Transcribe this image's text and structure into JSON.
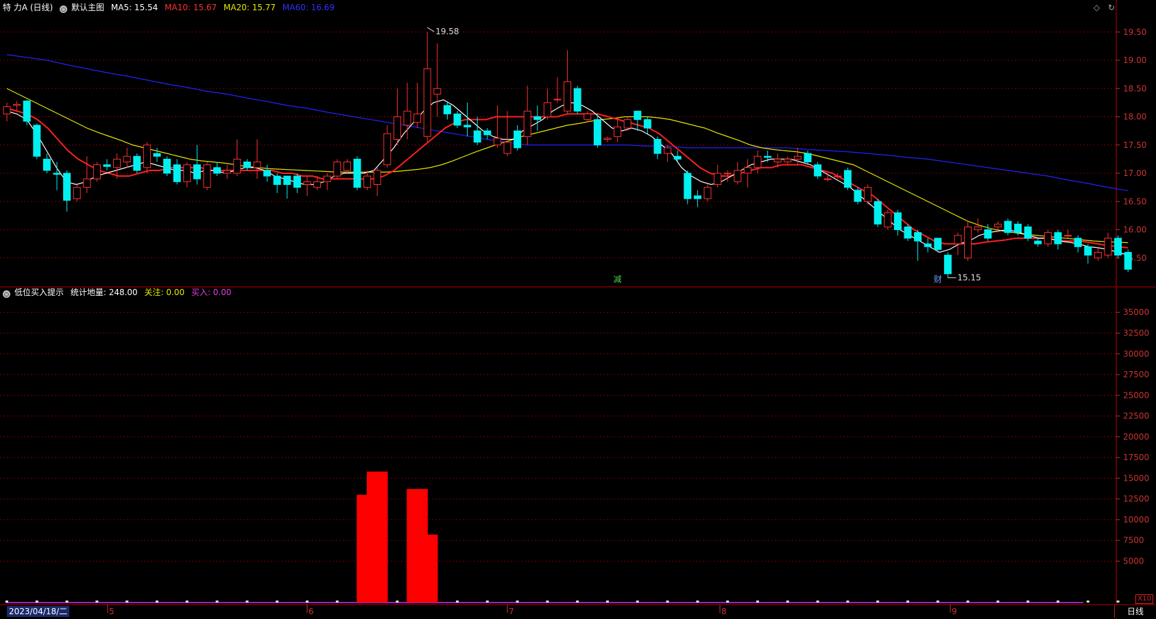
{
  "header": {
    "stock_title": "特 力A (日线)",
    "main_indicator": "默认主图",
    "ma5_label": "MA5: 15.54",
    "ma10_label": "MA10: 15.67",
    "ma20_label": "MA20: 15.77",
    "ma60_label": "MA60: 16.69"
  },
  "sub_header": {
    "indicator_name": "低位买入提示",
    "stat_label": "统计地量: 248.00",
    "watch_label": "关注: 0.00",
    "buy_label": "买入: 0.00"
  },
  "annotations": {
    "high_label": "19.58",
    "low_label": "15.15",
    "marker_jian": "减",
    "marker_cai": "财"
  },
  "price_axis_labels": [
    "19.50",
    "19.00",
    "18.50",
    "18.00",
    "17.50",
    "17.00",
    "16.50",
    "16.00",
    "15.50"
  ],
  "volume_axis_labels": [
    "35000",
    "32500",
    "30000",
    "27500",
    "25000",
    "22500",
    "20000",
    "17500",
    "15000",
    "12500",
    "10000",
    "7500",
    "5000"
  ],
  "x_axis": {
    "date_label": "2023/04/18/二",
    "month_labels": [
      "5",
      "6",
      "7",
      "8",
      "9"
    ]
  },
  "bottom_right": {
    "scale_label": "X10",
    "period_label": "日线"
  },
  "colors": {
    "up": "#ff3030",
    "down": "#00f0f0",
    "ma5": "#ffffff",
    "ma10": "#ff2020",
    "ma20": "#e8e800",
    "ma60": "#2222ff",
    "grid": "#7a0000",
    "axis_text": "#cc3333",
    "volume_bar": "#ff0000",
    "baseline": "#a020c0"
  },
  "icons": {
    "header_circle": "circle-icon",
    "diamond": "diamond-icon",
    "refresh": "refresh-icon"
  },
  "chart_data": {
    "type": "candlestick",
    "title": "特 力A (日线)",
    "ylim": [
      15.0,
      19.8
    ],
    "candles": [
      [
        18.05,
        18.18,
        17.92,
        18.25
      ],
      [
        18.2,
        18.22,
        18.1,
        18.28
      ],
      [
        18.28,
        17.92,
        17.85,
        18.3
      ],
      [
        17.85,
        17.3,
        17.25,
        17.88
      ],
      [
        17.25,
        17.05,
        17.0,
        17.35
      ],
      [
        17.0,
        16.98,
        16.7,
        17.2
      ],
      [
        17.0,
        16.52,
        16.32,
        17.05
      ],
      [
        16.55,
        16.75,
        16.5,
        16.8
      ],
      [
        16.75,
        16.9,
        16.65,
        17.3
      ],
      [
        16.9,
        17.15,
        16.85,
        17.2
      ],
      [
        17.15,
        17.12,
        17.05,
        17.25
      ],
      [
        17.1,
        17.25,
        16.9,
        17.35
      ],
      [
        17.2,
        17.3,
        17.1,
        17.45
      ],
      [
        17.3,
        17.05,
        17.0,
        17.35
      ],
      [
        17.1,
        17.5,
        17.0,
        17.55
      ],
      [
        17.35,
        17.3,
        17.2,
        17.45
      ],
      [
        17.25,
        17.0,
        16.95,
        17.3
      ],
      [
        17.15,
        16.85,
        16.8,
        17.25
      ],
      [
        16.85,
        17.15,
        16.75,
        17.2
      ],
      [
        17.15,
        16.9,
        16.8,
        17.5
      ],
      [
        16.75,
        17.15,
        16.7,
        17.2
      ],
      [
        17.1,
        17.0,
        16.95,
        17.2
      ],
      [
        17.0,
        17.05,
        16.9,
        17.15
      ],
      [
        17.0,
        17.25,
        16.95,
        17.6
      ],
      [
        17.2,
        17.1,
        17.05,
        17.25
      ],
      [
        17.1,
        17.2,
        16.9,
        17.6
      ],
      [
        17.05,
        16.95,
        16.85,
        17.15
      ],
      [
        16.95,
        16.8,
        16.65,
        17.0
      ],
      [
        16.95,
        16.8,
        16.55,
        16.95
      ],
      [
        16.95,
        16.75,
        16.65,
        17.0
      ],
      [
        16.8,
        16.85,
        16.6,
        16.95
      ],
      [
        16.75,
        16.85,
        16.7,
        16.95
      ],
      [
        16.85,
        16.95,
        16.7,
        17.0
      ],
      [
        16.95,
        17.2,
        16.9,
        17.25
      ],
      [
        17.05,
        17.2,
        17.0,
        17.25
      ],
      [
        17.25,
        16.75,
        16.7,
        17.3
      ],
      [
        16.75,
        16.95,
        16.7,
        17.05
      ],
      [
        16.8,
        17.05,
        16.6,
        17.1
      ],
      [
        17.15,
        17.7,
        17.1,
        17.85
      ],
      [
        17.6,
        18.0,
        17.5,
        18.5
      ],
      [
        17.85,
        18.1,
        17.6,
        18.6
      ],
      [
        17.9,
        18.05,
        17.8,
        18.6
      ],
      [
        17.65,
        18.85,
        17.55,
        19.5
      ],
      [
        18.4,
        18.5,
        18.0,
        19.3
      ],
      [
        18.2,
        18.05,
        17.95,
        18.25
      ],
      [
        18.05,
        17.85,
        17.8,
        18.1
      ],
      [
        17.85,
        17.82,
        17.65,
        18.25
      ],
      [
        17.75,
        17.55,
        17.5,
        18.0
      ],
      [
        17.75,
        17.68,
        17.6,
        17.8
      ],
      [
        17.5,
        17.62,
        17.45,
        18.2
      ],
      [
        17.35,
        17.55,
        17.3,
        18.1
      ],
      [
        17.75,
        17.45,
        17.4,
        17.85
      ],
      [
        17.65,
        18.1,
        17.5,
        18.55
      ],
      [
        18.0,
        17.95,
        17.75,
        18.2
      ],
      [
        18.0,
        18.25,
        17.95,
        18.5
      ],
      [
        18.3,
        18.31,
        18.25,
        18.7
      ],
      [
        18.1,
        18.62,
        18.05,
        19.18
      ],
      [
        18.5,
        18.1,
        18.05,
        18.55
      ],
      [
        17.95,
        18.05,
        17.9,
        18.1
      ],
      [
        17.95,
        17.5,
        17.45,
        18.05
      ],
      [
        17.6,
        17.62,
        17.55,
        17.65
      ],
      [
        17.65,
        17.82,
        17.55,
        18.0
      ],
      [
        17.8,
        17.95,
        17.75,
        18.0
      ],
      [
        18.1,
        17.95,
        17.75,
        18.1
      ],
      [
        17.95,
        17.8,
        17.7,
        18.0
      ],
      [
        17.6,
        17.35,
        17.25,
        17.65
      ],
      [
        17.35,
        17.45,
        17.2,
        17.5
      ],
      [
        17.3,
        17.25,
        17.2,
        17.4
      ],
      [
        17.0,
        16.55,
        16.45,
        17.05
      ],
      [
        16.6,
        16.55,
        16.4,
        16.7
      ],
      [
        16.55,
        16.75,
        16.5,
        16.8
      ],
      [
        16.8,
        17.0,
        16.75,
        17.15
      ],
      [
        17.0,
        17.0,
        16.85,
        17.05
      ],
      [
        16.85,
        17.05,
        16.8,
        17.2
      ],
      [
        17.0,
        17.1,
        16.75,
        17.25
      ],
      [
        17.1,
        17.3,
        17.0,
        17.4
      ],
      [
        17.3,
        17.28,
        17.2,
        17.4
      ],
      [
        17.2,
        17.25,
        17.1,
        17.35
      ],
      [
        17.2,
        17.25,
        17.15,
        17.3
      ],
      [
        17.25,
        17.3,
        17.15,
        17.45
      ],
      [
        17.35,
        17.2,
        17.15,
        17.4
      ],
      [
        17.15,
        16.95,
        16.9,
        17.2
      ],
      [
        16.9,
        16.9,
        16.85,
        17.0
      ],
      [
        16.95,
        16.95,
        16.9,
        17.0
      ],
      [
        17.05,
        16.75,
        16.7,
        17.1
      ],
      [
        16.7,
        16.5,
        16.45,
        16.75
      ],
      [
        16.5,
        16.75,
        16.45,
        16.8
      ],
      [
        16.5,
        16.1,
        16.05,
        16.55
      ],
      [
        16.05,
        16.3,
        16.0,
        16.35
      ],
      [
        16.3,
        16.0,
        15.9,
        16.35
      ],
      [
        16.05,
        15.85,
        15.8,
        16.1
      ],
      [
        15.95,
        15.8,
        15.45,
        16.0
      ],
      [
        15.75,
        15.7,
        15.6,
        15.85
      ],
      [
        15.85,
        15.65,
        15.6,
        15.85
      ],
      [
        15.55,
        15.22,
        15.15,
        15.6
      ],
      [
        15.75,
        15.9,
        15.55,
        15.95
      ],
      [
        15.5,
        16.05,
        15.45,
        16.15
      ],
      [
        16.0,
        16.05,
        15.95,
        16.2
      ],
      [
        16.0,
        15.85,
        15.8,
        16.1
      ],
      [
        16.05,
        16.1,
        15.95,
        16.15
      ],
      [
        16.15,
        15.95,
        15.9,
        16.2
      ],
      [
        16.1,
        15.95,
        15.9,
        16.15
      ],
      [
        16.05,
        15.85,
        15.8,
        16.1
      ],
      [
        15.8,
        15.75,
        15.7,
        15.85
      ],
      [
        15.75,
        15.95,
        15.7,
        16.0
      ],
      [
        15.95,
        15.75,
        15.65,
        16.0
      ],
      [
        15.9,
        15.9,
        15.85,
        16.0
      ],
      [
        15.85,
        15.7,
        15.6,
        15.9
      ],
      [
        15.7,
        15.55,
        15.4,
        15.75
      ],
      [
        15.5,
        15.6,
        15.45,
        15.7
      ],
      [
        15.55,
        15.85,
        15.5,
        15.95
      ],
      [
        15.85,
        15.55,
        15.5,
        15.9
      ],
      [
        15.6,
        15.3,
        15.25,
        15.65
      ]
    ],
    "ma5": [
      18.1,
      18.05,
      17.95,
      17.7,
      17.4,
      17.1,
      16.85,
      16.8,
      16.85,
      16.95,
      17.0,
      17.05,
      17.1,
      17.15,
      17.2,
      17.15,
      17.1,
      17.05,
      17.05,
      17.0,
      17.05,
      17.05,
      17.0,
      17.05,
      17.1,
      17.1,
      17.05,
      16.95,
      16.9,
      16.85,
      16.8,
      16.8,
      16.85,
      16.95,
      17.0,
      17.0,
      17.0,
      17.05,
      17.25,
      17.45,
      17.7,
      17.9,
      18.1,
      18.25,
      18.3,
      18.2,
      18.05,
      17.9,
      17.75,
      17.65,
      17.6,
      17.6,
      17.75,
      17.85,
      17.95,
      18.1,
      18.2,
      18.25,
      18.2,
      18.1,
      17.95,
      17.8,
      17.75,
      17.8,
      17.75,
      17.65,
      17.5,
      17.35,
      17.1,
      16.95,
      16.85,
      16.8,
      16.85,
      16.95,
      17.05,
      17.15,
      17.2,
      17.25,
      17.25,
      17.25,
      17.2,
      17.15,
      17.05,
      16.95,
      16.85,
      16.75,
      16.6,
      16.45,
      16.3,
      16.15,
      16.0,
      15.9,
      15.8,
      15.7,
      15.6,
      15.65,
      15.75,
      15.8,
      15.9,
      15.95,
      15.98,
      16.0,
      15.95,
      15.9,
      15.85,
      15.85,
      15.8,
      15.78,
      15.75,
      15.7,
      15.68,
      15.65,
      15.6,
      15.55
    ],
    "ma10": [
      18.15,
      18.1,
      18.05,
      17.95,
      17.8,
      17.6,
      17.4,
      17.25,
      17.15,
      17.05,
      17.0,
      16.95,
      16.95,
      17.0,
      17.05,
      17.05,
      17.1,
      17.1,
      17.1,
      17.1,
      17.05,
      17.05,
      17.05,
      17.05,
      17.05,
      17.05,
      17.05,
      17.0,
      17.0,
      16.95,
      16.95,
      16.9,
      16.9,
      16.9,
      16.9,
      16.9,
      16.9,
      16.95,
      17.05,
      17.2,
      17.35,
      17.5,
      17.65,
      17.8,
      17.9,
      17.95,
      17.95,
      17.95,
      18.0,
      18.0,
      18.0,
      18.0,
      18.0,
      18.0,
      18.0,
      18.05,
      18.05,
      18.05,
      18.05,
      18.0,
      17.95,
      17.9,
      17.85,
      17.8,
      17.7,
      17.55,
      17.4,
      17.25,
      17.1,
      17.0,
      16.95,
      16.95,
      17.0,
      17.05,
      17.1,
      17.1,
      17.15,
      17.15,
      17.15,
      17.1,
      17.05,
      17.0,
      16.9,
      16.8,
      16.7,
      16.6,
      16.45,
      16.3,
      16.15,
      16.0,
      15.9,
      15.8,
      15.75,
      15.75,
      15.75,
      15.75,
      15.78,
      15.8,
      15.82,
      15.85,
      15.85,
      15.85,
      15.85,
      15.82,
      15.8,
      15.8,
      15.78,
      15.75,
      15.72,
      15.7,
      15.68
    ],
    "ma20": [
      18.5,
      18.4,
      18.3,
      18.2,
      18.1,
      18.0,
      17.9,
      17.8,
      17.72,
      17.65,
      17.58,
      17.5,
      17.45,
      17.4,
      17.35,
      17.3,
      17.25,
      17.22,
      17.2,
      17.18,
      17.15,
      17.12,
      17.1,
      17.08,
      17.07,
      17.06,
      17.05,
      17.04,
      17.03,
      17.02,
      17.02,
      17.02,
      17.02,
      17.02,
      17.03,
      17.05,
      17.07,
      17.1,
      17.15,
      17.22,
      17.3,
      17.38,
      17.45,
      17.52,
      17.58,
      17.65,
      17.7,
      17.75,
      17.8,
      17.85,
      17.88,
      17.92,
      17.95,
      17.97,
      18.0,
      18.0,
      18.0,
      17.98,
      17.95,
      17.9,
      17.85,
      17.8,
      17.72,
      17.65,
      17.58,
      17.5,
      17.45,
      17.42,
      17.4,
      17.38,
      17.35,
      17.3,
      17.25,
      17.2,
      17.15,
      17.05,
      16.95,
      16.85,
      16.75,
      16.65,
      16.55,
      16.45,
      16.35,
      16.25,
      16.15,
      16.08,
      16.02,
      15.98,
      15.95,
      15.92,
      15.9,
      15.88,
      15.86,
      15.84,
      15.82,
      15.8,
      15.79,
      15.78,
      15.77
    ],
    "ma60": [
      19.1,
      19.05,
      19.0,
      18.92,
      18.85,
      18.78,
      18.72,
      18.65,
      18.58,
      18.52,
      18.45,
      18.4,
      18.33,
      18.27,
      18.2,
      18.15,
      18.08,
      18.02,
      17.96,
      17.9,
      17.84,
      17.78,
      17.72,
      17.66,
      17.6,
      17.55,
      17.5,
      17.5,
      17.5,
      17.5,
      17.5,
      17.5,
      17.48,
      17.48,
      17.45,
      17.45,
      17.45,
      17.45,
      17.45,
      17.45,
      17.42,
      17.4,
      17.38,
      17.35,
      17.32,
      17.28,
      17.25,
      17.2,
      17.15,
      17.1,
      17.05,
      17.0,
      16.95,
      16.88,
      16.82,
      16.75,
      16.69
    ],
    "volume_bars": [
      {
        "x": 35.5,
        "value": 13000
      },
      {
        "x": 36.5,
        "value": 15800
      },
      {
        "x": 37.5,
        "value": 15800
      },
      {
        "x": 40.5,
        "value": 13700
      },
      {
        "x": 41.5,
        "value": 13700
      },
      {
        "x": 42.5,
        "value": 8200
      }
    ],
    "volume_ylim": [
      0,
      37000
    ]
  }
}
